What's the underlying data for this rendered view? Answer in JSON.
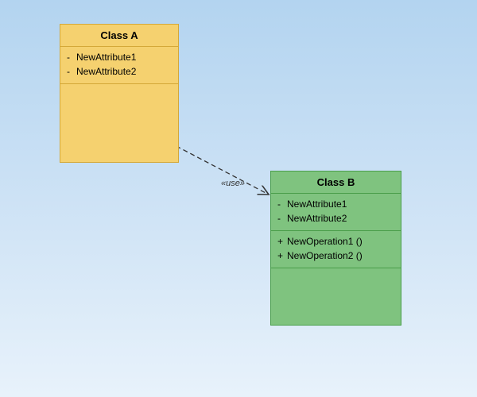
{
  "classA": {
    "name": "Class A",
    "attributes": [
      {
        "visibility": "-",
        "name": "NewAttribute1"
      },
      {
        "visibility": "-",
        "name": "NewAttribute2"
      }
    ],
    "operations": []
  },
  "classB": {
    "name": "Class B",
    "attributes": [
      {
        "visibility": "-",
        "name": "NewAttribute1"
      },
      {
        "visibility": "-",
        "name": "NewAttribute2"
      }
    ],
    "operations": [
      {
        "visibility": "+",
        "name": "NewOperation1 ()"
      },
      {
        "visibility": "+",
        "name": "NewOperation2 ()"
      }
    ]
  },
  "relationship": {
    "stereotype": "«use»",
    "type": "dependency"
  },
  "colors": {
    "classA_fill": "#f5d16f",
    "classA_border": "#d4a838",
    "classB_fill": "#7fc37f",
    "classB_border": "#4a9e4a"
  }
}
